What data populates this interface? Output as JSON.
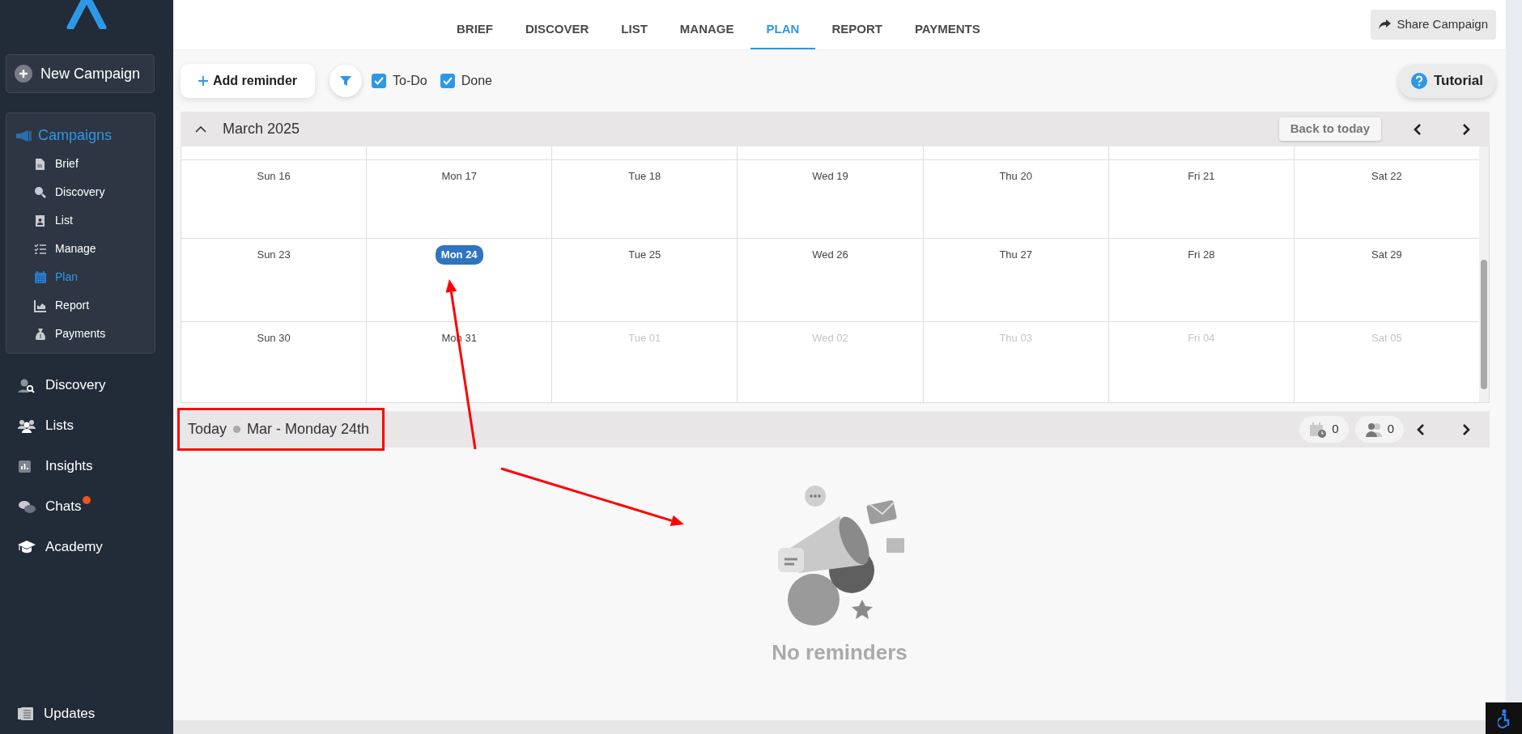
{
  "sidebar": {
    "new_campaign": "New Campaign",
    "section": {
      "label": "Campaigns",
      "items": [
        {
          "label": "Brief",
          "selected": false
        },
        {
          "label": "Discovery",
          "selected": false
        },
        {
          "label": "List",
          "selected": false
        },
        {
          "label": "Manage",
          "selected": false
        },
        {
          "label": "Plan",
          "selected": true
        },
        {
          "label": "Report",
          "selected": false
        },
        {
          "label": "Payments",
          "selected": false
        }
      ]
    },
    "nav": [
      {
        "label": "Discovery",
        "notification": false
      },
      {
        "label": "Lists",
        "notification": false
      },
      {
        "label": "Insights",
        "notification": false
      },
      {
        "label": "Chats",
        "notification": true
      },
      {
        "label": "Academy",
        "notification": false
      }
    ],
    "footer": "Updates"
  },
  "tabs": [
    {
      "label": "BRIEF",
      "selected": false
    },
    {
      "label": "DISCOVER",
      "selected": false
    },
    {
      "label": "LIST",
      "selected": false
    },
    {
      "label": "MANAGE",
      "selected": false
    },
    {
      "label": "PLAN",
      "selected": true
    },
    {
      "label": "REPORT",
      "selected": false
    },
    {
      "label": "PAYMENTS",
      "selected": false
    }
  ],
  "share_button": "Share Campaign",
  "toolbar": {
    "add_reminder": "Add reminder",
    "filters": [
      {
        "label": "To-Do",
        "checked": true
      },
      {
        "label": "Done",
        "checked": true
      }
    ],
    "tutorial": "Tutorial"
  },
  "calendar": {
    "month": "March 2025",
    "expanded": true,
    "back_to_today": "Back to today",
    "weeks": [
      [
        {
          "label": "Sun 16",
          "today": false,
          "other_month": false
        },
        {
          "label": "Mon 17",
          "today": false,
          "other_month": false
        },
        {
          "label": "Tue 18",
          "today": false,
          "other_month": false
        },
        {
          "label": "Wed 19",
          "today": false,
          "other_month": false
        },
        {
          "label": "Thu 20",
          "today": false,
          "other_month": false
        },
        {
          "label": "Fri 21",
          "today": false,
          "other_month": false
        },
        {
          "label": "Sat 22",
          "today": false,
          "other_month": false
        }
      ],
      [
        {
          "label": "Sun 23",
          "today": false,
          "other_month": false
        },
        {
          "label": "Mon 24",
          "today": true,
          "other_month": false
        },
        {
          "label": "Tue 25",
          "today": false,
          "other_month": false
        },
        {
          "label": "Wed 26",
          "today": false,
          "other_month": false
        },
        {
          "label": "Thu 27",
          "today": false,
          "other_month": false
        },
        {
          "label": "Fri 28",
          "today": false,
          "other_month": false
        },
        {
          "label": "Sat 29",
          "today": false,
          "other_month": false
        }
      ],
      [
        {
          "label": "Sun 30",
          "today": false,
          "other_month": false
        },
        {
          "label": "Mon 31",
          "today": false,
          "other_month": false
        },
        {
          "label": "Tue 01",
          "today": false,
          "other_month": true
        },
        {
          "label": "Wed 02",
          "today": false,
          "other_month": true
        },
        {
          "label": "Thu 03",
          "today": false,
          "other_month": true
        },
        {
          "label": "Fri 04",
          "today": false,
          "other_month": true
        },
        {
          "label": "Sat 05",
          "today": false,
          "other_month": true
        }
      ]
    ]
  },
  "day_bar": {
    "today_label": "Today",
    "date": "Mar - Monday 24th",
    "highlighted": true,
    "reminders_count": "0",
    "people_count": "0"
  },
  "empty_state": "No reminders",
  "annotations": [
    {
      "kind": "arrow"
    },
    {
      "kind": "arrow"
    }
  ]
}
